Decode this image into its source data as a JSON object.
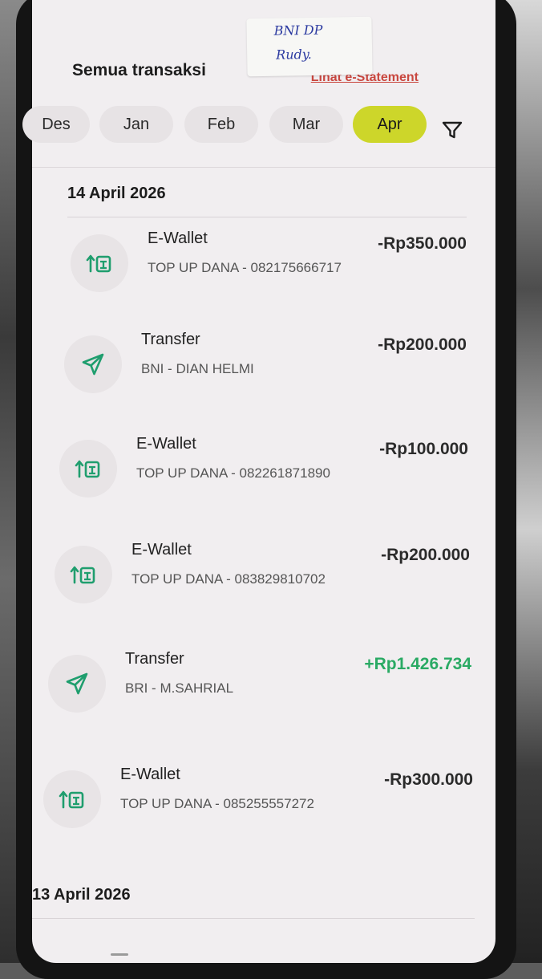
{
  "sticky_note": {
    "line1": "BNI DP",
    "line2": "Rudy."
  },
  "header": {
    "title": "Semua transaksi",
    "statement_link": "Lihat e-Statement"
  },
  "months": [
    {
      "label": "Des",
      "active": false
    },
    {
      "label": "Jan",
      "active": false
    },
    {
      "label": "Feb",
      "active": false
    },
    {
      "label": "Mar",
      "active": false
    },
    {
      "label": "Apr",
      "active": true
    }
  ],
  "filter_icon": "filter-funnel-icon",
  "groups": [
    {
      "date": "14 April 2026",
      "transactions": [
        {
          "icon": "ewallet-topup-icon",
          "category": "E-Wallet",
          "description": "TOP UP DANA - 082175666717",
          "amount": "-Rp350.000",
          "type": "debit"
        },
        {
          "icon": "send-paper-plane-icon",
          "category": "Transfer",
          "description": "BNI - DIAN HELMI",
          "amount": "-Rp200.000",
          "type": "debit"
        },
        {
          "icon": "ewallet-topup-icon",
          "category": "E-Wallet",
          "description": "TOP UP DANA - 082261871890",
          "amount": "-Rp100.000",
          "type": "debit"
        },
        {
          "icon": "ewallet-topup-icon",
          "category": "E-Wallet",
          "description": "TOP UP DANA - 083829810702",
          "amount": "-Rp200.000",
          "type": "debit"
        },
        {
          "icon": "send-paper-plane-icon",
          "category": "Transfer",
          "description": "BRI - M.SAHRIAL",
          "amount": "+Rp1.426.734",
          "type": "credit"
        },
        {
          "icon": "ewallet-topup-icon",
          "category": "E-Wallet",
          "description": "TOP UP DANA - 085255557272",
          "amount": "-Rp300.000",
          "type": "debit"
        }
      ]
    },
    {
      "date": "13 April 2026",
      "transactions": []
    }
  ],
  "colors": {
    "accent": "#cdd62a",
    "credit": "#2aaa64",
    "icon": "#1f9e6e",
    "link": "#c9473f"
  }
}
